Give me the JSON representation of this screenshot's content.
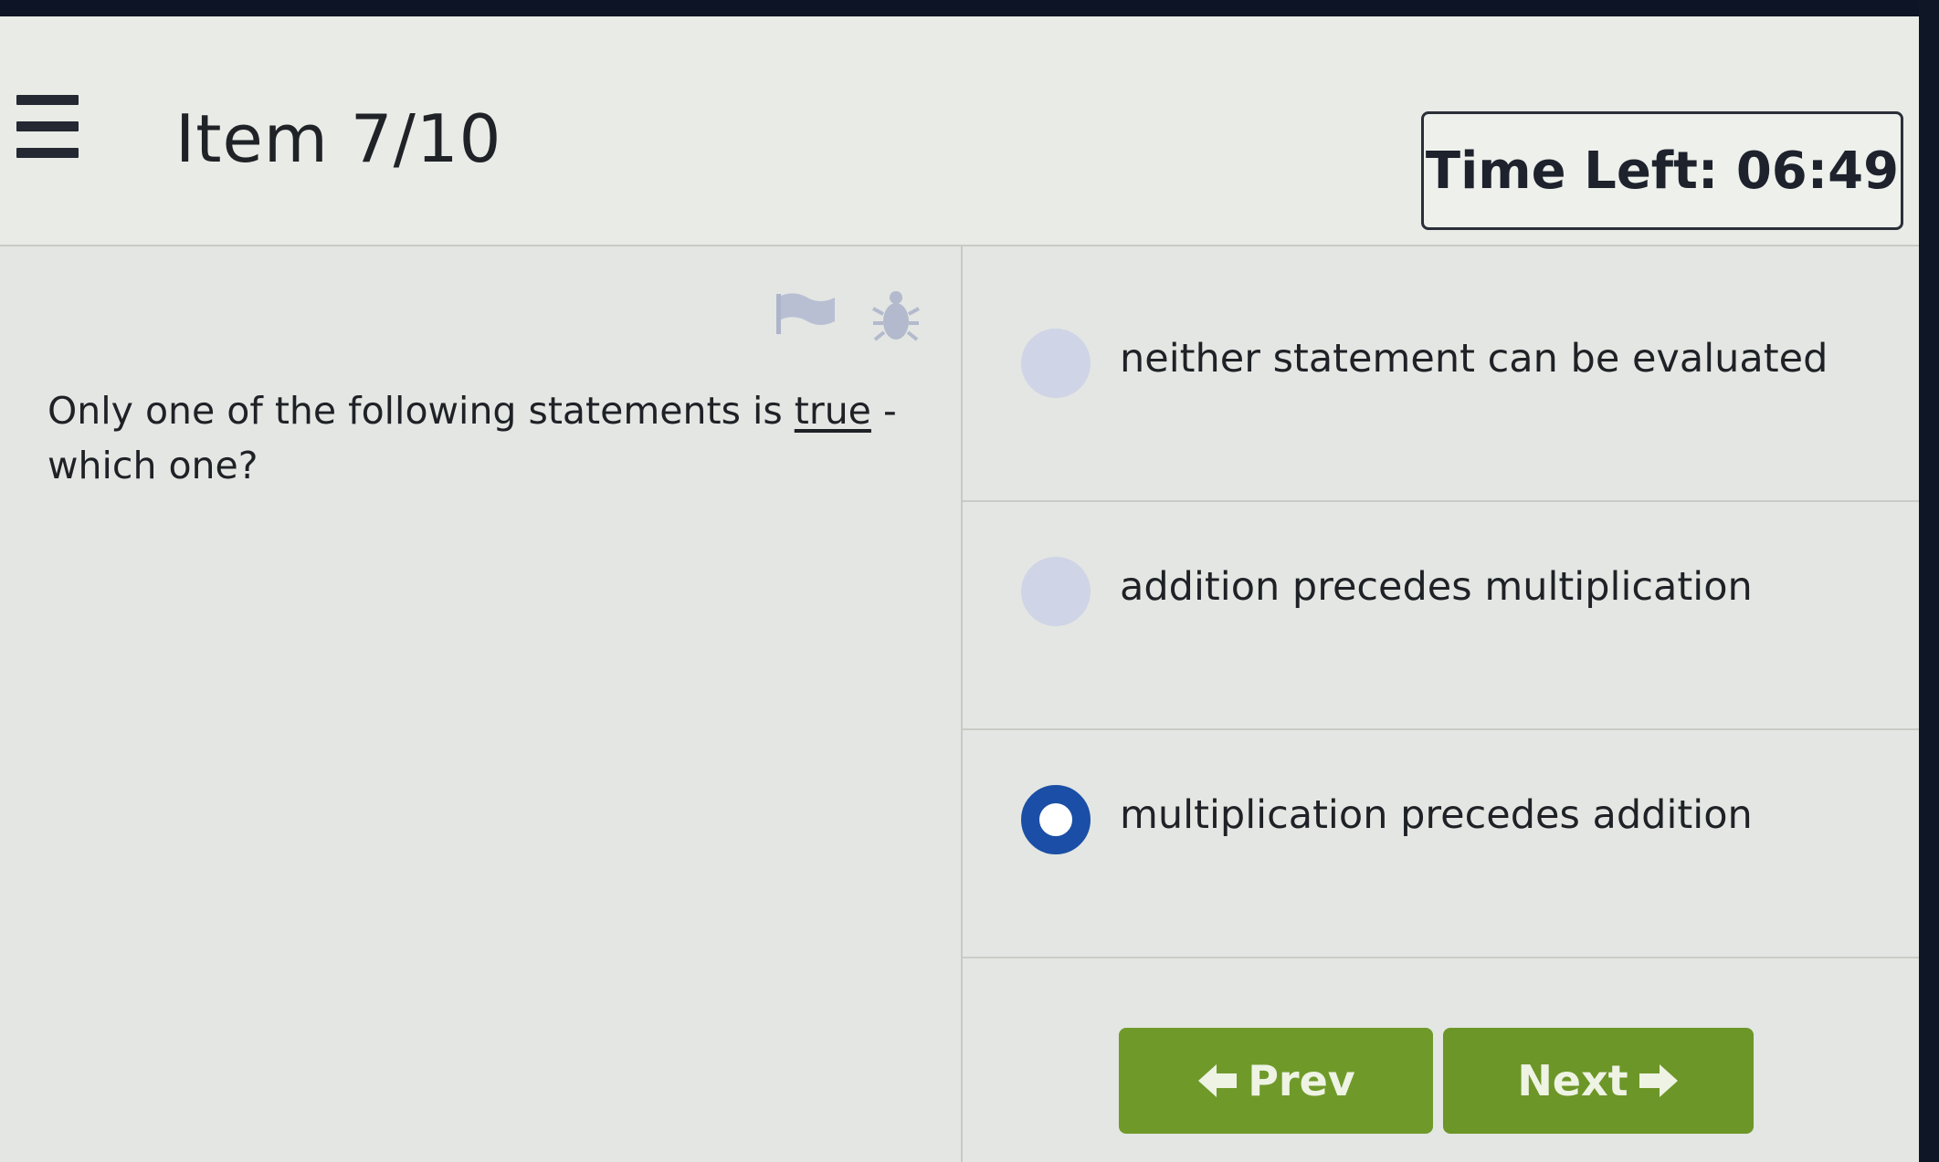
{
  "header": {
    "menu_icon": "hamburger-menu-icon",
    "item_label": "Item 7/10",
    "timer_text": "Time Left: 06:49"
  },
  "toolbar": {
    "flag_icon": "flag-icon",
    "report_icon": "bug-icon"
  },
  "question": {
    "text_before": "Only one of the following statements is ",
    "emphasis": "true",
    "text_after": " - which one?"
  },
  "choices": [
    {
      "label": "neither statement can be evaluated",
      "selected": false
    },
    {
      "label": "addition precedes multiplication",
      "selected": false
    },
    {
      "label": "multiplication precedes addition",
      "selected": true
    }
  ],
  "navigation": {
    "prev_label": "Prev",
    "next_label": "Next",
    "prev_icon": "arrow-left-icon",
    "next_icon": "arrow-right-icon"
  },
  "colors": {
    "selected_radio": "#1b4ea6",
    "unselected_radio": "#cfd4e6",
    "nav_button": "#6f9a2a",
    "top_band": "#0c1426"
  }
}
